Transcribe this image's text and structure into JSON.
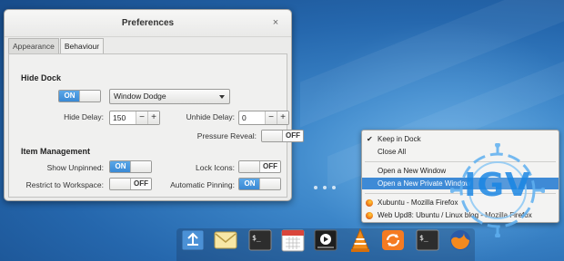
{
  "window": {
    "title": "Preferences",
    "close_glyph": "×",
    "tabs": [
      {
        "label": "Appearance",
        "active": false
      },
      {
        "label": "Behaviour",
        "active": true
      }
    ]
  },
  "behaviour": {
    "hide_dock": {
      "section": "Hide Dock",
      "toggle": "ON",
      "mode_value": "Window Dodge",
      "hide_delay_label": "Hide Delay:",
      "hide_delay_value": "150",
      "unhide_delay_label": "Unhide Delay:",
      "unhide_delay_value": "0",
      "pressure_reveal_label": "Pressure Reveal:",
      "pressure_reveal_state": "OFF"
    },
    "item_management": {
      "section": "Item Management",
      "show_unpinned_label": "Show Unpinned:",
      "show_unpinned_state": "ON",
      "lock_icons_label": "Lock Icons:",
      "lock_icons_state": "OFF",
      "restrict_label": "Restrict to Workspace:",
      "restrict_state": "OFF",
      "auto_pinning_label": "Automatic Pinning:",
      "auto_pinning_state": "ON"
    },
    "spin_minus": "−",
    "spin_plus": "+"
  },
  "context_menu": {
    "keep_in_dock": "Keep in Dock",
    "keep_in_dock_checked": "✔",
    "close_all": "Close All",
    "open_new_window": "Open a New Window",
    "open_new_private": "Open a New Private Window",
    "window_items": [
      "Xubuntu - Mozilla Firefox",
      "Web Upd8: Ubuntu / Linux blog - Mozilla Firefox"
    ]
  },
  "dock": {
    "items": [
      "files-icon",
      "mail-icon",
      "terminal-icon",
      "calendar-icon",
      "video-player-icon",
      "vlc-icon",
      "update-icon",
      "terminal-icon",
      "firefox-icon"
    ]
  },
  "watermark": {
    "text": "IGV"
  },
  "colors": {
    "accent": "#3e8ad6",
    "watermark": "#1d88e5"
  }
}
